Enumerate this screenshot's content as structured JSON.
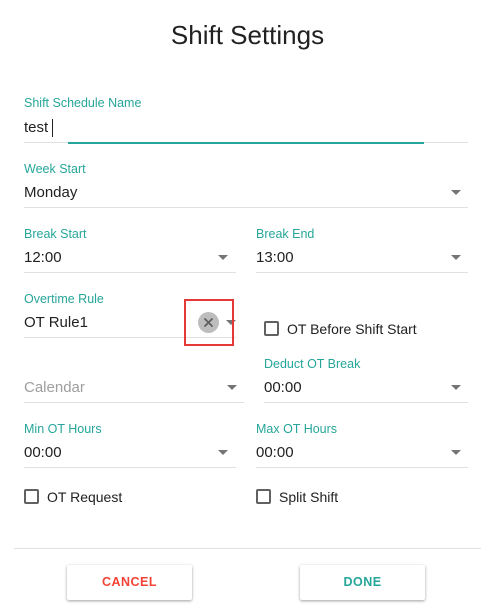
{
  "dialog": {
    "title": "Shift Settings"
  },
  "fields": {
    "schedule_name": {
      "label": "Shift Schedule Name",
      "value": "test"
    },
    "week_start": {
      "label": "Week Start",
      "value": "Monday"
    },
    "break_start": {
      "label": "Break Start",
      "value": "12:00"
    },
    "break_end": {
      "label": "Break End",
      "value": "13:00"
    },
    "overtime_rule": {
      "label": "Overtime Rule",
      "value": "OT Rule1",
      "clear_icon": "close-icon"
    },
    "calendar": {
      "placeholder": "Calendar"
    },
    "deduct_ot_break": {
      "label": "Deduct OT Break",
      "value": "00:00"
    },
    "min_ot_hours": {
      "label": "Min OT Hours",
      "value": "00:00"
    },
    "max_ot_hours": {
      "label": "Max OT Hours",
      "value": "00:00"
    }
  },
  "checkboxes": {
    "ot_before_shift_start": {
      "label": "OT Before Shift Start",
      "checked": false
    },
    "ot_request": {
      "label": "OT Request",
      "checked": false
    },
    "split_shift": {
      "label": "Split Shift",
      "checked": false
    }
  },
  "actions": {
    "cancel_label": "CANCEL",
    "done_label": "DONE"
  },
  "colors": {
    "accent": "#26a69a",
    "cancel": "#f44336",
    "highlight": "#e53935"
  }
}
